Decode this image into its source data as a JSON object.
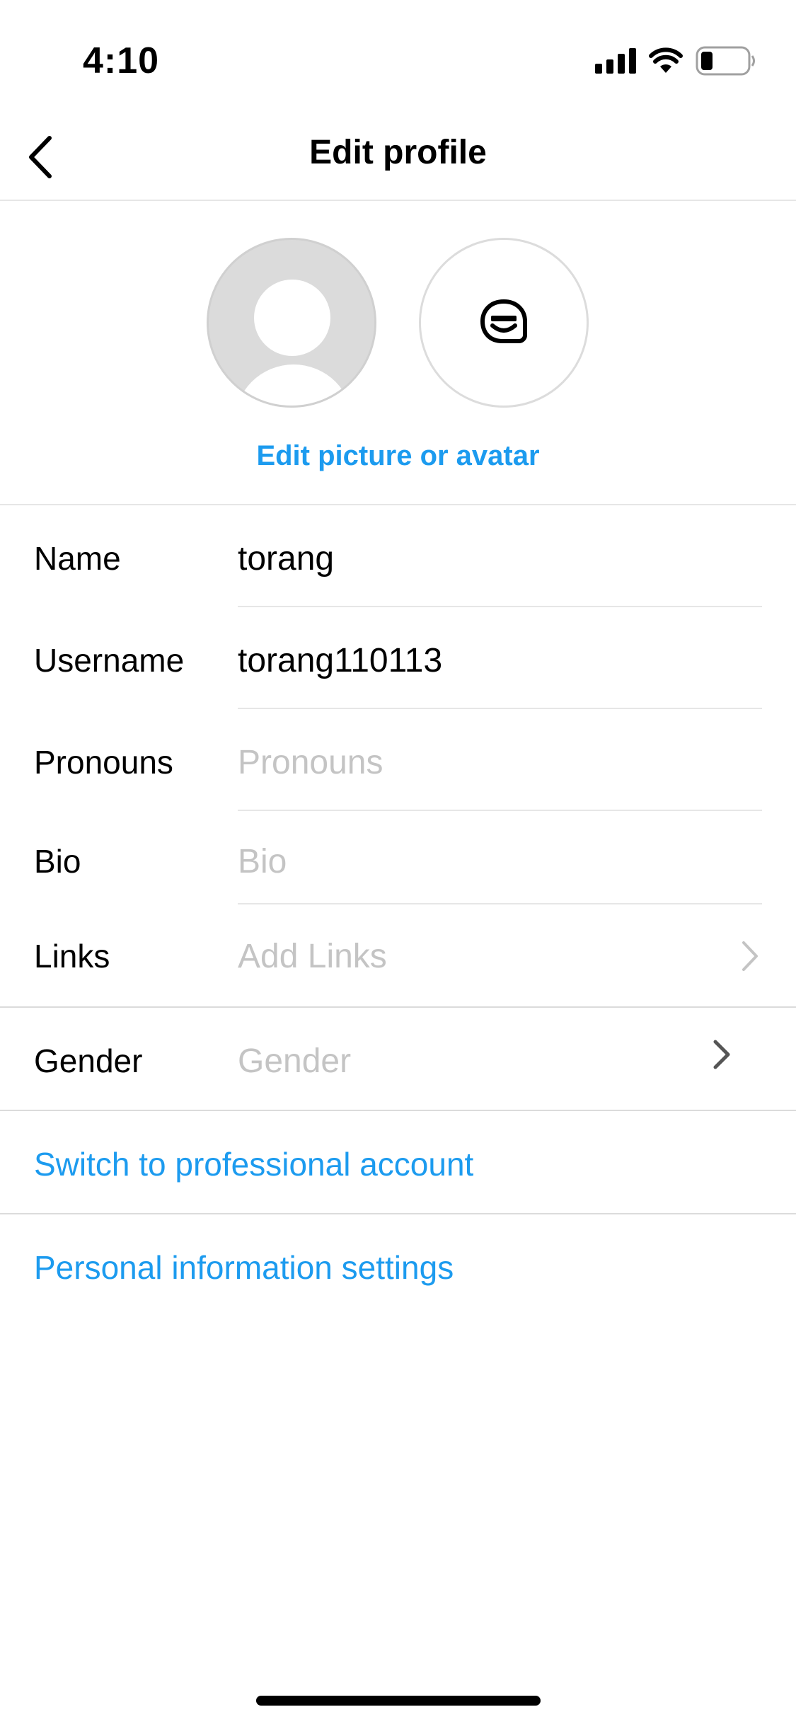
{
  "status_bar": {
    "time": "4:10",
    "icons": [
      "signal-icon",
      "wifi-icon",
      "battery-icon"
    ]
  },
  "nav": {
    "title": "Edit profile",
    "back_icon": "chevron-left-icon"
  },
  "avatar_section": {
    "photo_icon": "default-avatar-icon",
    "avatar_icon": "avatar-face-icon",
    "edit_link": "Edit picture or avatar"
  },
  "form": {
    "name": {
      "label": "Name",
      "value": "torang"
    },
    "username": {
      "label": "Username",
      "value": "torang110113"
    },
    "pronouns": {
      "label": "Pronouns",
      "placeholder": "Pronouns"
    },
    "bio": {
      "label": "Bio",
      "placeholder": "Bio"
    },
    "links": {
      "label": "Links",
      "placeholder": "Add Links"
    },
    "gender": {
      "label": "Gender",
      "placeholder": "Gender"
    }
  },
  "actions": {
    "switch_professional": "Switch to professional account",
    "personal_info": "Personal information settings"
  },
  "colors": {
    "accent": "#1c9bef",
    "placeholder": "#c4c4c4",
    "divider": "#e6e6e6"
  }
}
